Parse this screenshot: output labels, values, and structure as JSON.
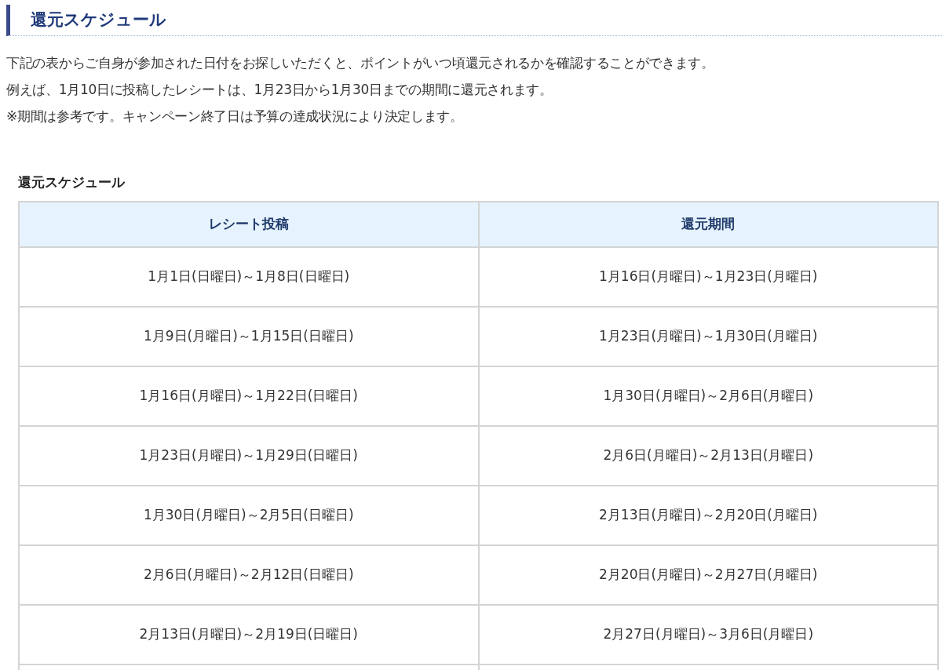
{
  "heading": "還元スケジュール",
  "intro": [
    "下記の表からご自身が参加された日付をお探しいただくと、ポイントがいつ頃還元されるかを確認することができます。",
    "例えば、1月10日に投稿したレシートは、1月23日から1月30日までの期間に還元されます。",
    "※期間は参考です。キャンペーン終了日は予算の達成状況により決定します。"
  ],
  "table": {
    "caption": "還元スケジュール",
    "columns": [
      "レシート投稿",
      "還元期間"
    ],
    "rows": [
      [
        "1月1日(日曜日)～1月8日(日曜日)",
        "1月16日(月曜日)～1月23日(月曜日)"
      ],
      [
        "1月9日(月曜日)～1月15日(日曜日)",
        "1月23日(月曜日)～1月30日(月曜日)"
      ],
      [
        "1月16日(月曜日)～1月22日(日曜日)",
        "1月30日(月曜日)～2月6日(月曜日)"
      ],
      [
        "1月23日(月曜日)～1月29日(日曜日)",
        "2月6日(月曜日)～2月13日(月曜日)"
      ],
      [
        "1月30日(月曜日)～2月5日(日曜日)",
        "2月13日(月曜日)～2月20日(月曜日)"
      ],
      [
        "2月6日(月曜日)～2月12日(日曜日)",
        "2月20日(月曜日)～2月27日(月曜日)"
      ],
      [
        "2月13日(月曜日)～2月19日(日曜日)",
        "2月27日(月曜日)～3月6日(月曜日)"
      ]
    ]
  }
}
